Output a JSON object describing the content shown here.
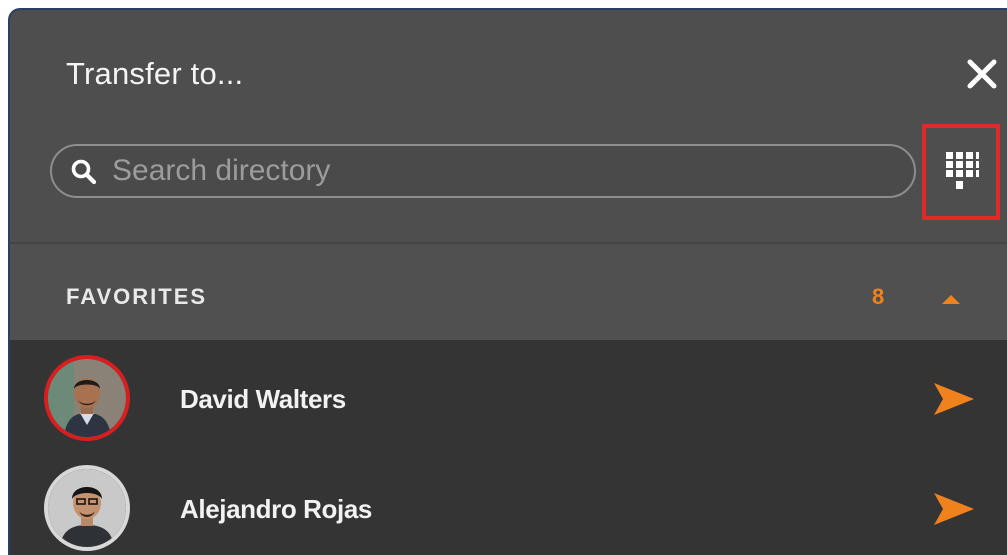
{
  "dialog": {
    "title": "Transfer to..."
  },
  "search": {
    "placeholder": "Search directory",
    "value": ""
  },
  "section": {
    "title": "FAVORITES",
    "count": "8"
  },
  "contacts": [
    {
      "name": "David Walters",
      "favorite": true
    },
    {
      "name": "Alejandro Rojas",
      "favorite": false
    }
  ],
  "icons": {
    "close": "close-icon",
    "search": "search-icon",
    "dialpad": "dialpad-icon",
    "collapse": "chevron-up-icon",
    "send": "send-icon"
  },
  "colors": {
    "accent": "#f0821e",
    "highlight": "#e02a2a",
    "panel_bg": "#4e4e4e",
    "list_bg": "#343434"
  }
}
